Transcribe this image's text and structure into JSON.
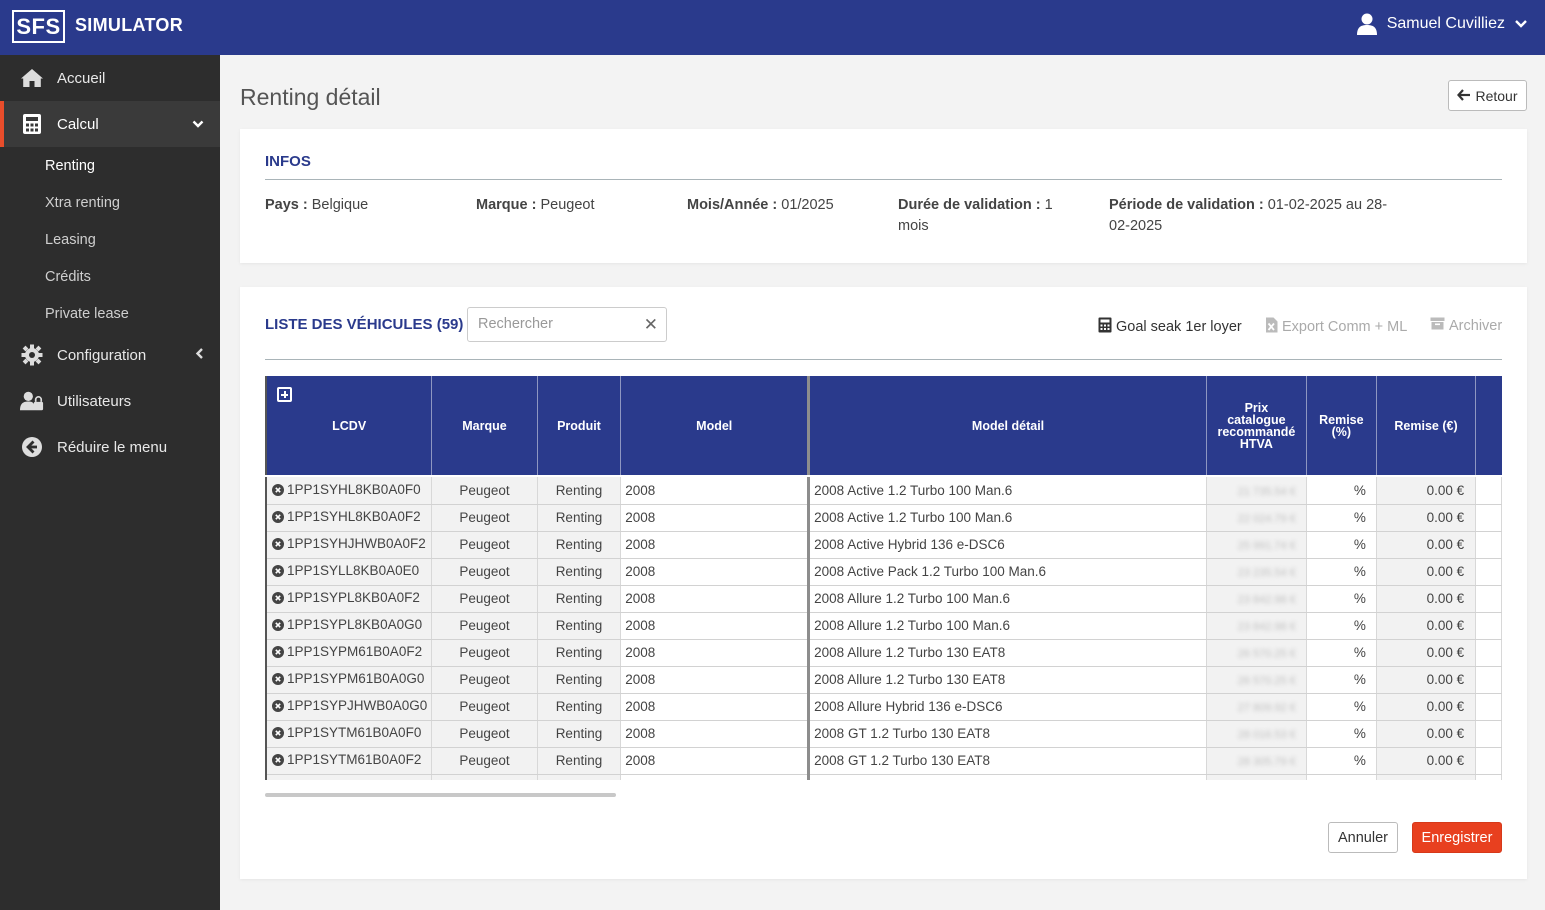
{
  "app": {
    "logo": "SFS",
    "title": "SIMULATOR",
    "user_name": "Samuel Cuvilliez"
  },
  "sidebar": {
    "items": [
      {
        "label": "Accueil",
        "icon": "home-icon"
      },
      {
        "label": "Calcul",
        "icon": "calculator-icon",
        "active": true
      },
      {
        "label": "Configuration",
        "icon": "gear-icon"
      },
      {
        "label": "Utilisateurs",
        "icon": "users-icon"
      },
      {
        "label": "Réduire le menu",
        "icon": "arrow-left-circle-icon"
      }
    ],
    "calcul_sub": [
      "Renting",
      "Xtra renting",
      "Leasing",
      "Crédits",
      "Private lease"
    ]
  },
  "page": {
    "title": "Renting détail",
    "back_label": "Retour"
  },
  "infos": {
    "title": "INFOS",
    "pays_label": "Pays :",
    "pays_value": "Belgique",
    "marque_label": "Marque :",
    "marque_value": "Peugeot",
    "mois_label": "Mois/Année :",
    "mois_value": "01/2025",
    "duree_label": "Durée de validation :",
    "duree_value": "1 mois",
    "periode_label": "Période de validation :",
    "periode_value": "01-02-2025 au 28-02-2025"
  },
  "list": {
    "title": "LISTE DES VÉHICULES (59)",
    "search_placeholder": "Rechercher",
    "clear_symbol": "✕",
    "tools": {
      "goal_seek": "Goal seak 1er loyer",
      "export": "Export Comm + ML",
      "archive": "Archiver"
    },
    "columns": {
      "lcdv": "LCDV",
      "marque": "Marque",
      "produit": "Produit",
      "model": "Model",
      "model_detail": "Model détail",
      "prix": "Prix catalogue recommandé HTVA",
      "remise_pct": "Remise (%)",
      "remise_eur": "Remise (€)"
    },
    "rows": [
      {
        "lcdv": "1PP1SYHL8KB0A0F0",
        "marque": "Peugeot",
        "produit": "Renting",
        "model": "2008",
        "detail": "2008 Active 1.2 Turbo  100 Man.6",
        "prix": "21 735.54 €",
        "pct": "%",
        "eur": "0.00 €"
      },
      {
        "lcdv": "1PP1SYHL8KB0A0F2",
        "marque": "Peugeot",
        "produit": "Renting",
        "model": "2008",
        "detail": "2008 Active 1.2 Turbo 100 Man.6",
        "prix": "22 024.79 €",
        "pct": "%",
        "eur": "0.00 €"
      },
      {
        "lcdv": "1PP1SYHJHWB0A0F2",
        "marque": "Peugeot",
        "produit": "Renting",
        "model": "2008",
        "detail": "2008 Active Hybrid 136 e-DSC6",
        "prix": "25 991.74 €",
        "pct": "%",
        "eur": "0.00 €"
      },
      {
        "lcdv": "1PP1SYLL8KB0A0E0",
        "marque": "Peugeot",
        "produit": "Renting",
        "model": "2008",
        "detail": "2008 Active Pack 1.2 Turbo  100 Man.6",
        "prix": "23 235.54 €",
        "pct": "%",
        "eur": "0.00 €"
      },
      {
        "lcdv": "1PP1SYPL8KB0A0F2",
        "marque": "Peugeot",
        "produit": "Renting",
        "model": "2008",
        "detail": "2008 Allure 1.2 Turbo  100 Man.6",
        "prix": "23 842.98 €",
        "pct": "%",
        "eur": "0.00 €"
      },
      {
        "lcdv": "1PP1SYPL8KB0A0G0",
        "marque": "Peugeot",
        "produit": "Renting",
        "model": "2008",
        "detail": "2008 Allure 1.2 Turbo  100 Man.6",
        "prix": "23 842.98 €",
        "pct": "%",
        "eur": "0.00 €"
      },
      {
        "lcdv": "1PP1SYPM61B0A0F2",
        "marque": "Peugeot",
        "produit": "Renting",
        "model": "2008",
        "detail": "2008 Allure 1.2 Turbo  130 EAT8",
        "prix": "26 570.25 €",
        "pct": "%",
        "eur": "0.00 €"
      },
      {
        "lcdv": "1PP1SYPM61B0A0G0",
        "marque": "Peugeot",
        "produit": "Renting",
        "model": "2008",
        "detail": "2008 Allure 1.2 Turbo  130 EAT8",
        "prix": "26 570.25 €",
        "pct": "%",
        "eur": "0.00 €"
      },
      {
        "lcdv": "1PP1SYPJHWB0A0G0",
        "marque": "Peugeot",
        "produit": "Renting",
        "model": "2008",
        "detail": "2008 Allure Hybrid 136 e-DSC6",
        "prix": "27 809.92 €",
        "pct": "%",
        "eur": "0.00 €"
      },
      {
        "lcdv": "1PP1SYTM61B0A0F0",
        "marque": "Peugeot",
        "produit": "Renting",
        "model": "2008",
        "detail": "2008 GT 1.2 Turbo  130 EAT8",
        "prix": "28 016.53 €",
        "pct": "%",
        "eur": "0.00 €"
      },
      {
        "lcdv": "1PP1SYTM61B0A0F2",
        "marque": "Peugeot",
        "produit": "Renting",
        "model": "2008",
        "detail": "2008 GT 1.2 Turbo  130 EAT8",
        "prix": "28 305.79 €",
        "pct": "%",
        "eur": "0.00 €"
      },
      {
        "lcdv": "",
        "marque": "",
        "produit": "",
        "model": "",
        "detail": "",
        "prix": "",
        "pct": "",
        "eur": ""
      }
    ]
  },
  "actions": {
    "cancel": "Annuler",
    "save": "Enregistrer"
  },
  "colors": {
    "primary": "#2a3a8c",
    "accent": "#e8401f",
    "sidebar": "#2d2d2d"
  }
}
